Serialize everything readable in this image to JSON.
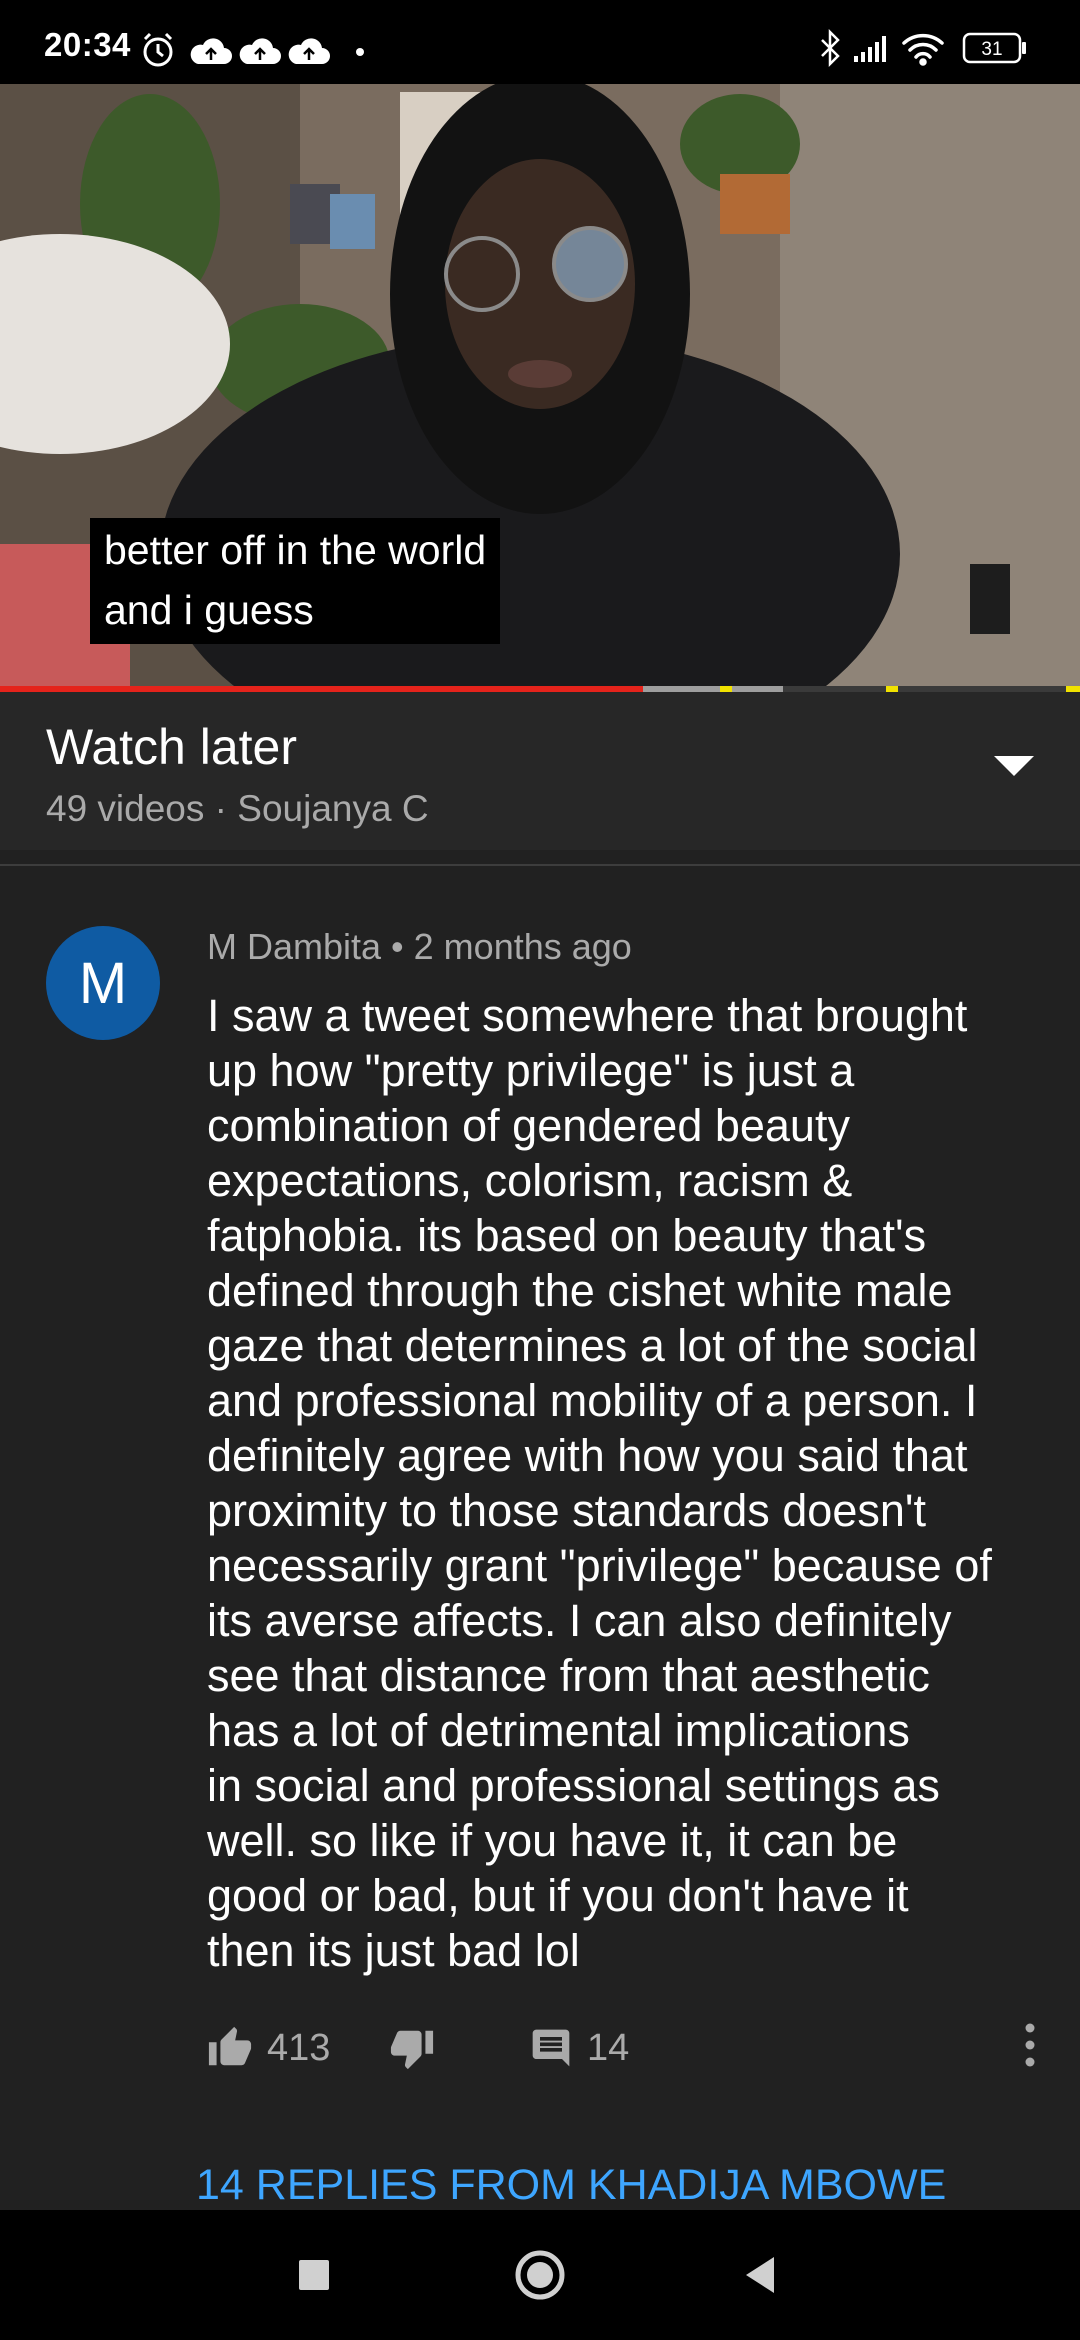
{
  "status_bar": {
    "time": "20:34",
    "battery": "31",
    "icons": [
      "alarm-icon",
      "cloud-upload-icon",
      "cloud-upload-icon",
      "cloud-upload-icon",
      "dot-icon",
      "bluetooth-icon",
      "signal-icon",
      "wifi-icon",
      "battery-icon"
    ]
  },
  "video": {
    "caption_lines": [
      "better off in the world",
      "and i guess"
    ],
    "progress": {
      "played": 0.595,
      "buffered_until": 0.725
    }
  },
  "playlist": {
    "title": "Watch later",
    "subtitle": "49 videos · Soujanya C"
  },
  "comment": {
    "avatar_letter": "M",
    "author": "M Dambita",
    "time": "2 months ago",
    "lines": [
      "I saw a tweet somewhere that brought",
      "up how \"pretty privilege\" is just a",
      "combination of gendered beauty",
      "expectations, colorism, racism &",
      "fatphobia. its based on beauty that's",
      "defined through the cishet white male",
      "gaze that determines a lot of the social",
      "and professional mobility of a person. I",
      "definitely agree with how you said that",
      "proximity to those standards doesn't",
      "necessarily grant \"privilege\" because of",
      "its averse affects. I can also definitely",
      "see that distance from that aesthetic",
      "has a lot of detrimental implications",
      "in social and professional settings as",
      "well. so like if you have it, it can be",
      "good or bad, but if you don't have it",
      "then its just bad lol"
    ],
    "likes": "413",
    "replies_count": "14",
    "replies_link": "14 REPLIES FROM KHADIJA MBOWE"
  },
  "colors": {
    "background": "#212121",
    "accent_link": "#3ea6ff",
    "avatar": "#0f5ba3",
    "progress_played": "#e5231b"
  }
}
